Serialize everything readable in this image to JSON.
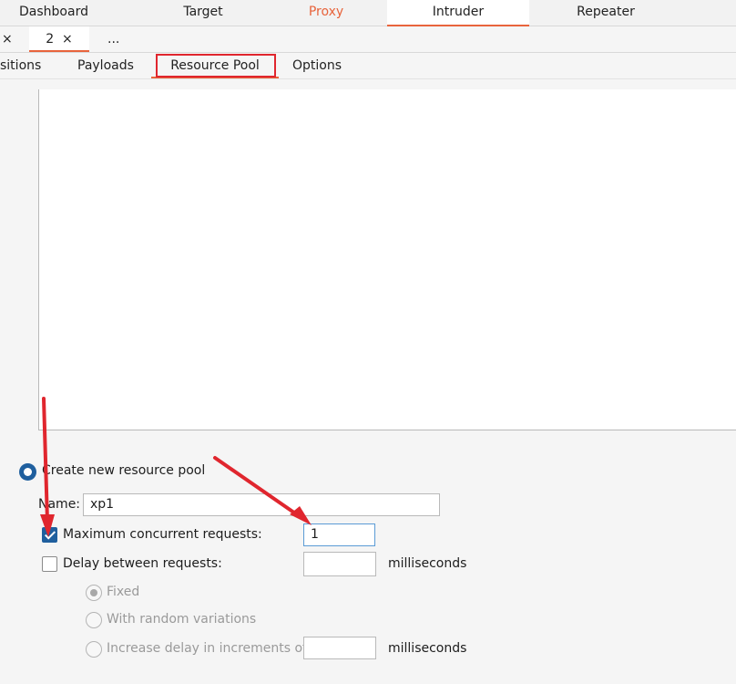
{
  "top_tabs": [
    {
      "label": "Dashboard"
    },
    {
      "label": "Target"
    },
    {
      "label": "Proxy"
    },
    {
      "label": "Intruder"
    },
    {
      "label": "Repeater"
    }
  ],
  "sub_tabs": [
    {
      "label": "×"
    },
    {
      "label": "2  ×"
    },
    {
      "label": "..."
    }
  ],
  "section_tabs": [
    {
      "label": "sitions"
    },
    {
      "label": "Payloads"
    },
    {
      "label": "Resource Pool"
    },
    {
      "label": "Options"
    }
  ],
  "form": {
    "create_pool_label": "Create new resource pool",
    "name_label": "Name:",
    "name_value": "xp1",
    "max_concurrent_label": "Maximum concurrent requests:",
    "max_concurrent_value": "1",
    "delay_label": "Delay between requests:",
    "delay_value": "",
    "delay_units": "milliseconds",
    "fixed_label": "Fixed",
    "random_label": "With random variations",
    "increase_label": "Increase delay in increments of",
    "increase_value": "",
    "increase_units": "milliseconds"
  },
  "colors": {
    "accent": "#e8643c",
    "checkbox": "#1f5f9e",
    "annotation": "#e0262e"
  }
}
